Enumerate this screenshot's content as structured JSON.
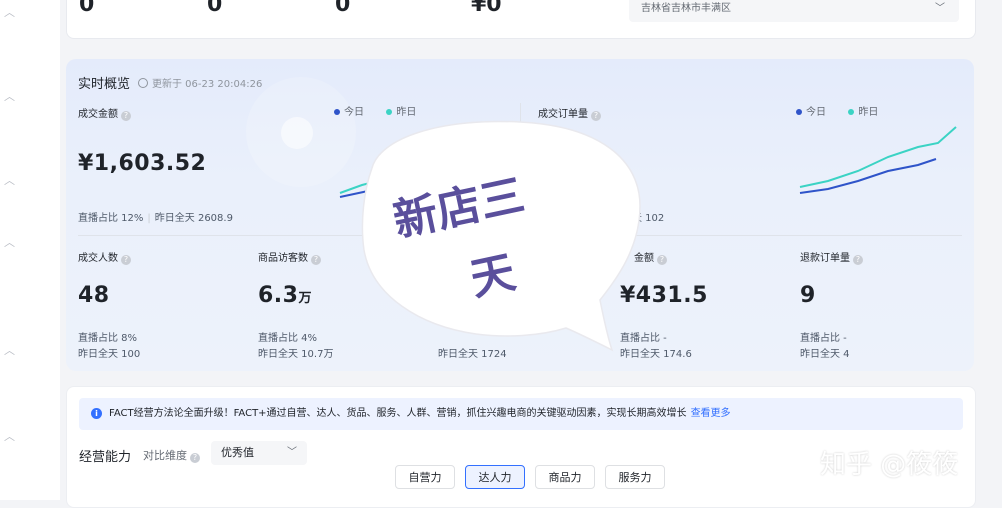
{
  "top": {
    "numbers": [
      "0",
      "0",
      "0",
      "¥0"
    ],
    "region": "吉林省吉林市丰满区"
  },
  "realtime": {
    "title": "实时概览",
    "updated": "更新于 06-23 20:04:26",
    "legend_today": "今日",
    "legend_yesterday": "昨日",
    "colors": {
      "today": "#2f54c9",
      "yesterday": "#3bd3c4"
    },
    "gmv": {
      "label": "成交金额",
      "value": "¥1,603.52",
      "live_share": "直播占比 12%",
      "yesterday_total": "昨日全天 2608.9"
    },
    "orders": {
      "label": "成交订单量",
      "yesterday_total_partial": "天 102"
    },
    "metrics": [
      {
        "label": "成交人数",
        "value": "48",
        "unit": "",
        "line1": "直播占比 8%",
        "line2": "昨日全天 100"
      },
      {
        "label": "商品访客数",
        "value": "6.3",
        "unit": "万",
        "line1": "直播占比 4%",
        "line2": "昨日全天 10.7万"
      },
      {
        "label": "",
        "value": "",
        "unit": "",
        "line1": "",
        "line2": "昨日全天 1724"
      },
      {
        "label": "金额",
        "value": "¥431.5",
        "unit": "",
        "line1": "直播占比 -",
        "line2": "昨日全天 174.6"
      },
      {
        "label": "退款订单量",
        "value": "9",
        "unit": "",
        "line1": "直播占比 -",
        "line2": "昨日全天 4"
      }
    ]
  },
  "overlay": {
    "line1": "新店三",
    "line2": "天"
  },
  "business": {
    "notice": "FACT经营方法论全面升级！FACT+通过自营、达人、货品、服务、人群、营销，抓住兴趣电商的关键驱动因素，实现长期高效增长",
    "notice_link": "查看更多",
    "title": "经营能力",
    "compare_label": "对比维度",
    "compare_value": "优秀值",
    "tabs": [
      "自营力",
      "达人力",
      "商品力",
      "服务力"
    ]
  },
  "watermark": "知乎 @筱筱"
}
